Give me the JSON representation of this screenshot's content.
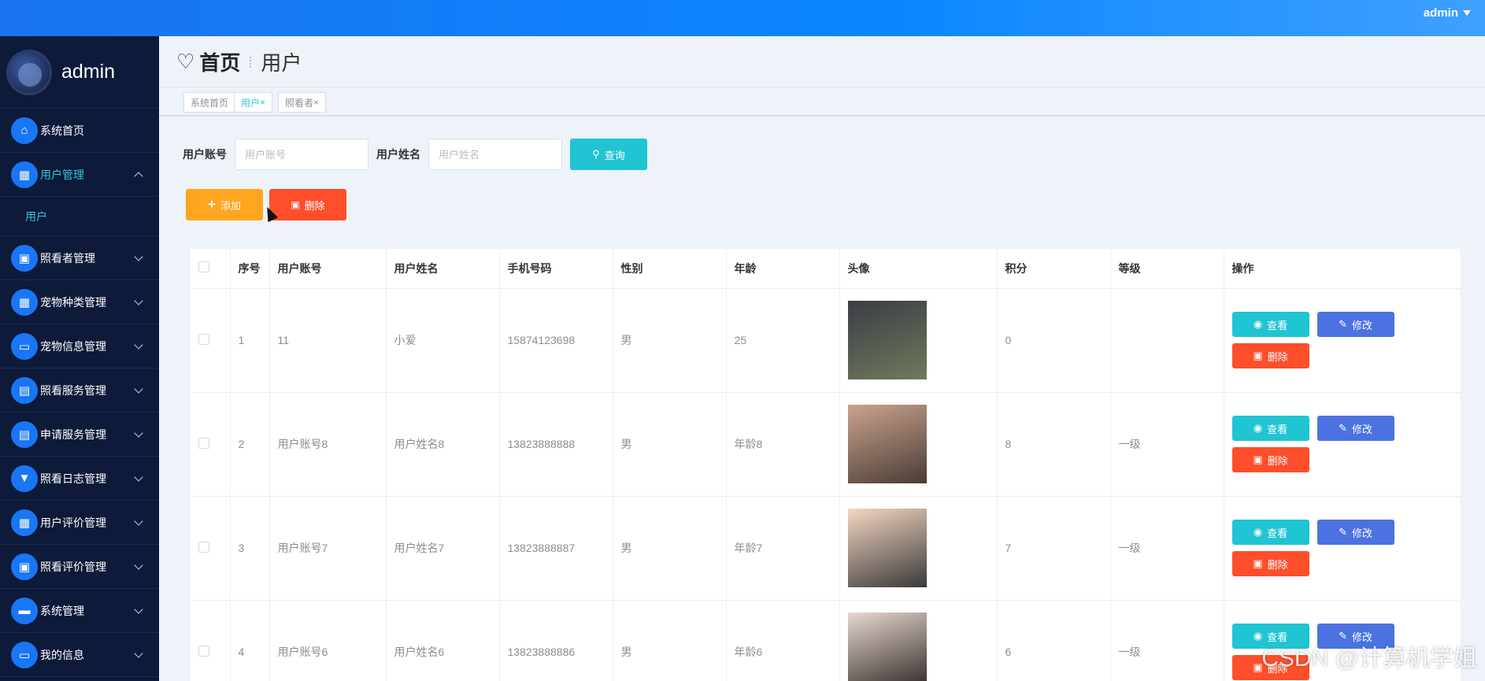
{
  "topbar": {
    "user": "admin"
  },
  "sidebar": {
    "username": "admin",
    "items": [
      {
        "label": "系统首页",
        "icon": "home-icon",
        "glyph": "⌂",
        "active": false,
        "expanded": false,
        "chevron": false
      },
      {
        "label": "用户管理",
        "icon": "grid-icon",
        "glyph": "▦",
        "active": true,
        "expanded": true,
        "chevron": true
      },
      {
        "label": "照看者管理",
        "icon": "briefcase-icon",
        "glyph": "▣",
        "active": false,
        "expanded": false,
        "chevron": true
      },
      {
        "label": "宠物种类管理",
        "icon": "grid-icon",
        "glyph": "▦",
        "active": false,
        "expanded": false,
        "chevron": true
      },
      {
        "label": "宠物信息管理",
        "icon": "monitor-icon",
        "glyph": "▭",
        "active": false,
        "expanded": false,
        "chevron": true
      },
      {
        "label": "照看服务管理",
        "icon": "document-icon",
        "glyph": "▤",
        "active": false,
        "expanded": false,
        "chevron": true
      },
      {
        "label": "申请服务管理",
        "icon": "clipboard-icon",
        "glyph": "▤",
        "active": false,
        "expanded": false,
        "chevron": true
      },
      {
        "label": "照看日志管理",
        "icon": "pin-icon",
        "glyph": "▼",
        "active": false,
        "expanded": false,
        "chevron": true
      },
      {
        "label": "用户评价管理",
        "icon": "grid-icon",
        "glyph": "▦",
        "active": false,
        "expanded": false,
        "chevron": true
      },
      {
        "label": "照看评价管理",
        "icon": "checklist-icon",
        "glyph": "▣",
        "active": false,
        "expanded": false,
        "chevron": true
      },
      {
        "label": "系统管理",
        "icon": "chat-icon",
        "glyph": "▬",
        "active": false,
        "expanded": false,
        "chevron": true
      },
      {
        "label": "我的信息",
        "icon": "card-icon",
        "glyph": "▭",
        "active": false,
        "expanded": false,
        "chevron": true
      }
    ],
    "subitem": "用户"
  },
  "breadcrumb": {
    "home": "首页",
    "current": "用户"
  },
  "tabs": [
    {
      "label": "系统首页",
      "closable": false
    },
    {
      "label": "用户",
      "closable": true
    },
    {
      "label": "照看者",
      "closable": true
    }
  ],
  "search": {
    "account_label": "用户账号",
    "account_placeholder": "用户账号",
    "name_label": "用户姓名",
    "name_placeholder": "用户姓名",
    "query_label": "查询"
  },
  "actions": {
    "add_label": "添加",
    "delete_label": "删除"
  },
  "table": {
    "headers": [
      "序号",
      "用户账号",
      "用户姓名",
      "手机号码",
      "性别",
      "年龄",
      "头像",
      "积分",
      "等级",
      "操作"
    ],
    "rows": [
      {
        "index": "1",
        "account": "11",
        "name": "小爱",
        "phone": "15874123698",
        "gender": "男",
        "age": "25",
        "points": "0",
        "level": "",
        "avatar_tone": [
          "#3b3d45",
          "#6f7a5c"
        ]
      },
      {
        "index": "2",
        "account": "用户账号8",
        "name": "用户姓名8",
        "phone": "13823888888",
        "gender": "男",
        "age": "年龄8",
        "points": "8",
        "level": "一级",
        "avatar_tone": [
          "#caa48d",
          "#4a3c36"
        ]
      },
      {
        "index": "3",
        "account": "用户账号7",
        "name": "用户姓名7",
        "phone": "13823888887",
        "gender": "男",
        "age": "年龄7",
        "points": "7",
        "level": "一级",
        "avatar_tone": [
          "#f4d7c2",
          "#3a3a3a"
        ]
      },
      {
        "index": "4",
        "account": "用户账号6",
        "name": "用户姓名6",
        "phone": "13823888886",
        "gender": "男",
        "age": "年龄6",
        "points": "6",
        "level": "一级",
        "avatar_tone": [
          "#e8d8d0",
          "#2b2523"
        ]
      }
    ],
    "ops": {
      "view": "查看",
      "edit": "修改",
      "remove": "删除"
    }
  },
  "watermark": "CSDN @计算机学姐",
  "colors": {
    "topbar": "#1a73f0",
    "sidebar": "#0d1a3a",
    "accent": "#21c4d2",
    "add": "#ffa51f",
    "danger": "#ff4e2a",
    "edit": "#4b72e0"
  }
}
